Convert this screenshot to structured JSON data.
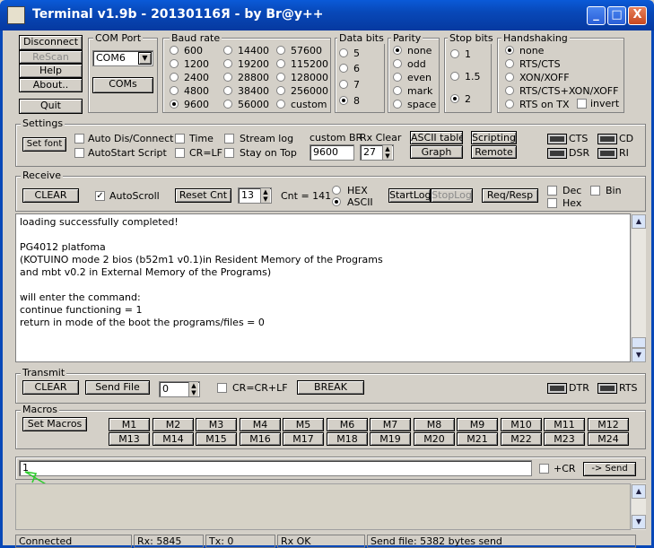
{
  "title": "Terminal v1.9b - 20130116Я - by Br@y++",
  "window_buttons": {
    "min": "_",
    "max": "□",
    "close": "X"
  },
  "left_buttons": [
    "Disconnect",
    "ReScan",
    "Help",
    "About..",
    "Quit"
  ],
  "com_port": {
    "label": "COM Port",
    "value": "COM6",
    "coms_button": "COMs"
  },
  "baud": {
    "label": "Baud rate",
    "options": [
      "600",
      "1200",
      "2400",
      "4800",
      "9600",
      "14400",
      "19200",
      "28800",
      "38400",
      "56000",
      "57600",
      "115200",
      "128000",
      "256000",
      "custom"
    ],
    "selected": "9600"
  },
  "data_bits": {
    "label": "Data bits",
    "options": [
      "5",
      "6",
      "7",
      "8"
    ],
    "selected": "8"
  },
  "parity": {
    "label": "Parity",
    "options": [
      "none",
      "odd",
      "even",
      "mark",
      "space"
    ],
    "selected": "none"
  },
  "stop_bits": {
    "label": "Stop bits",
    "options": [
      "1",
      "1.5",
      "2"
    ],
    "selected": "2"
  },
  "handshaking": {
    "label": "Handshaking",
    "options": [
      "none",
      "RTS/CTS",
      "XON/XOFF",
      "RTS/CTS+XON/XOFF",
      "RTS on TX"
    ],
    "selected": "none",
    "invert": "invert"
  },
  "settings": {
    "label": "Settings",
    "set_font": "Set font",
    "checks": [
      "Auto Dis/Connect",
      "AutoStart Script",
      "Time",
      "CR=LF",
      "Stream log",
      "Stay on Top"
    ],
    "custom_br_label": "custom BR",
    "custom_br_value": "9600",
    "rx_clear_label": "Rx Clear",
    "rx_clear_value": "27",
    "ascii_table": "ASCII table",
    "graph": "Graph",
    "scripting": "Scripting",
    "remote": "Remote",
    "leds": [
      "CTS",
      "CD",
      "DSR",
      "RI"
    ]
  },
  "receive": {
    "label": "Receive",
    "clear": "CLEAR",
    "autoscroll": "AutoScroll",
    "reset_cnt": "Reset Cnt",
    "cnt_value": "13",
    "cnt_text": "Cnt =  141",
    "hex": "HEX",
    "ascii": "ASCII",
    "startlog": "StartLog",
    "stoplog": "StopLog",
    "reqresp": "Req/Resp",
    "dec": "Dec",
    "bin": "Bin",
    "hexchk": "Hex",
    "text": "loading successfully completed!\n\nPG4012 platfoma\n(KOTUINO mode 2 bios (b52m1 v0.1)in Resident Memory of the Programs\nand mbt v0.2 in External Memory of the Programs)\n\nwill enter the command:\ncontinue functioning = 1\nreturn in mode of the boot the programs/files = 0"
  },
  "transmit": {
    "label": "Transmit",
    "clear": "CLEAR",
    "send_file": "Send File",
    "spin_value": "0",
    "crcrlf": "CR=CR+LF",
    "break": "BREAK",
    "dtr": "DTR",
    "rts": "RTS"
  },
  "macros": {
    "label": "Macros",
    "set_macros": "Set Macros",
    "row1": [
      "M1",
      "M2",
      "M3",
      "M4",
      "M5",
      "M6",
      "M7",
      "M8",
      "M9",
      "M10",
      "M11",
      "M12"
    ],
    "row2": [
      "M13",
      "M14",
      "M15",
      "M16",
      "M17",
      "M18",
      "M19",
      "M20",
      "M21",
      "M22",
      "M23",
      "M24"
    ]
  },
  "send": {
    "value": "1",
    "cr": "+CR",
    "button": "-> Send"
  },
  "statusbar": [
    "Connected",
    "Rx: 5845",
    "Tx: 0",
    "Rx OK",
    "Send file: 5382 bytes send"
  ]
}
